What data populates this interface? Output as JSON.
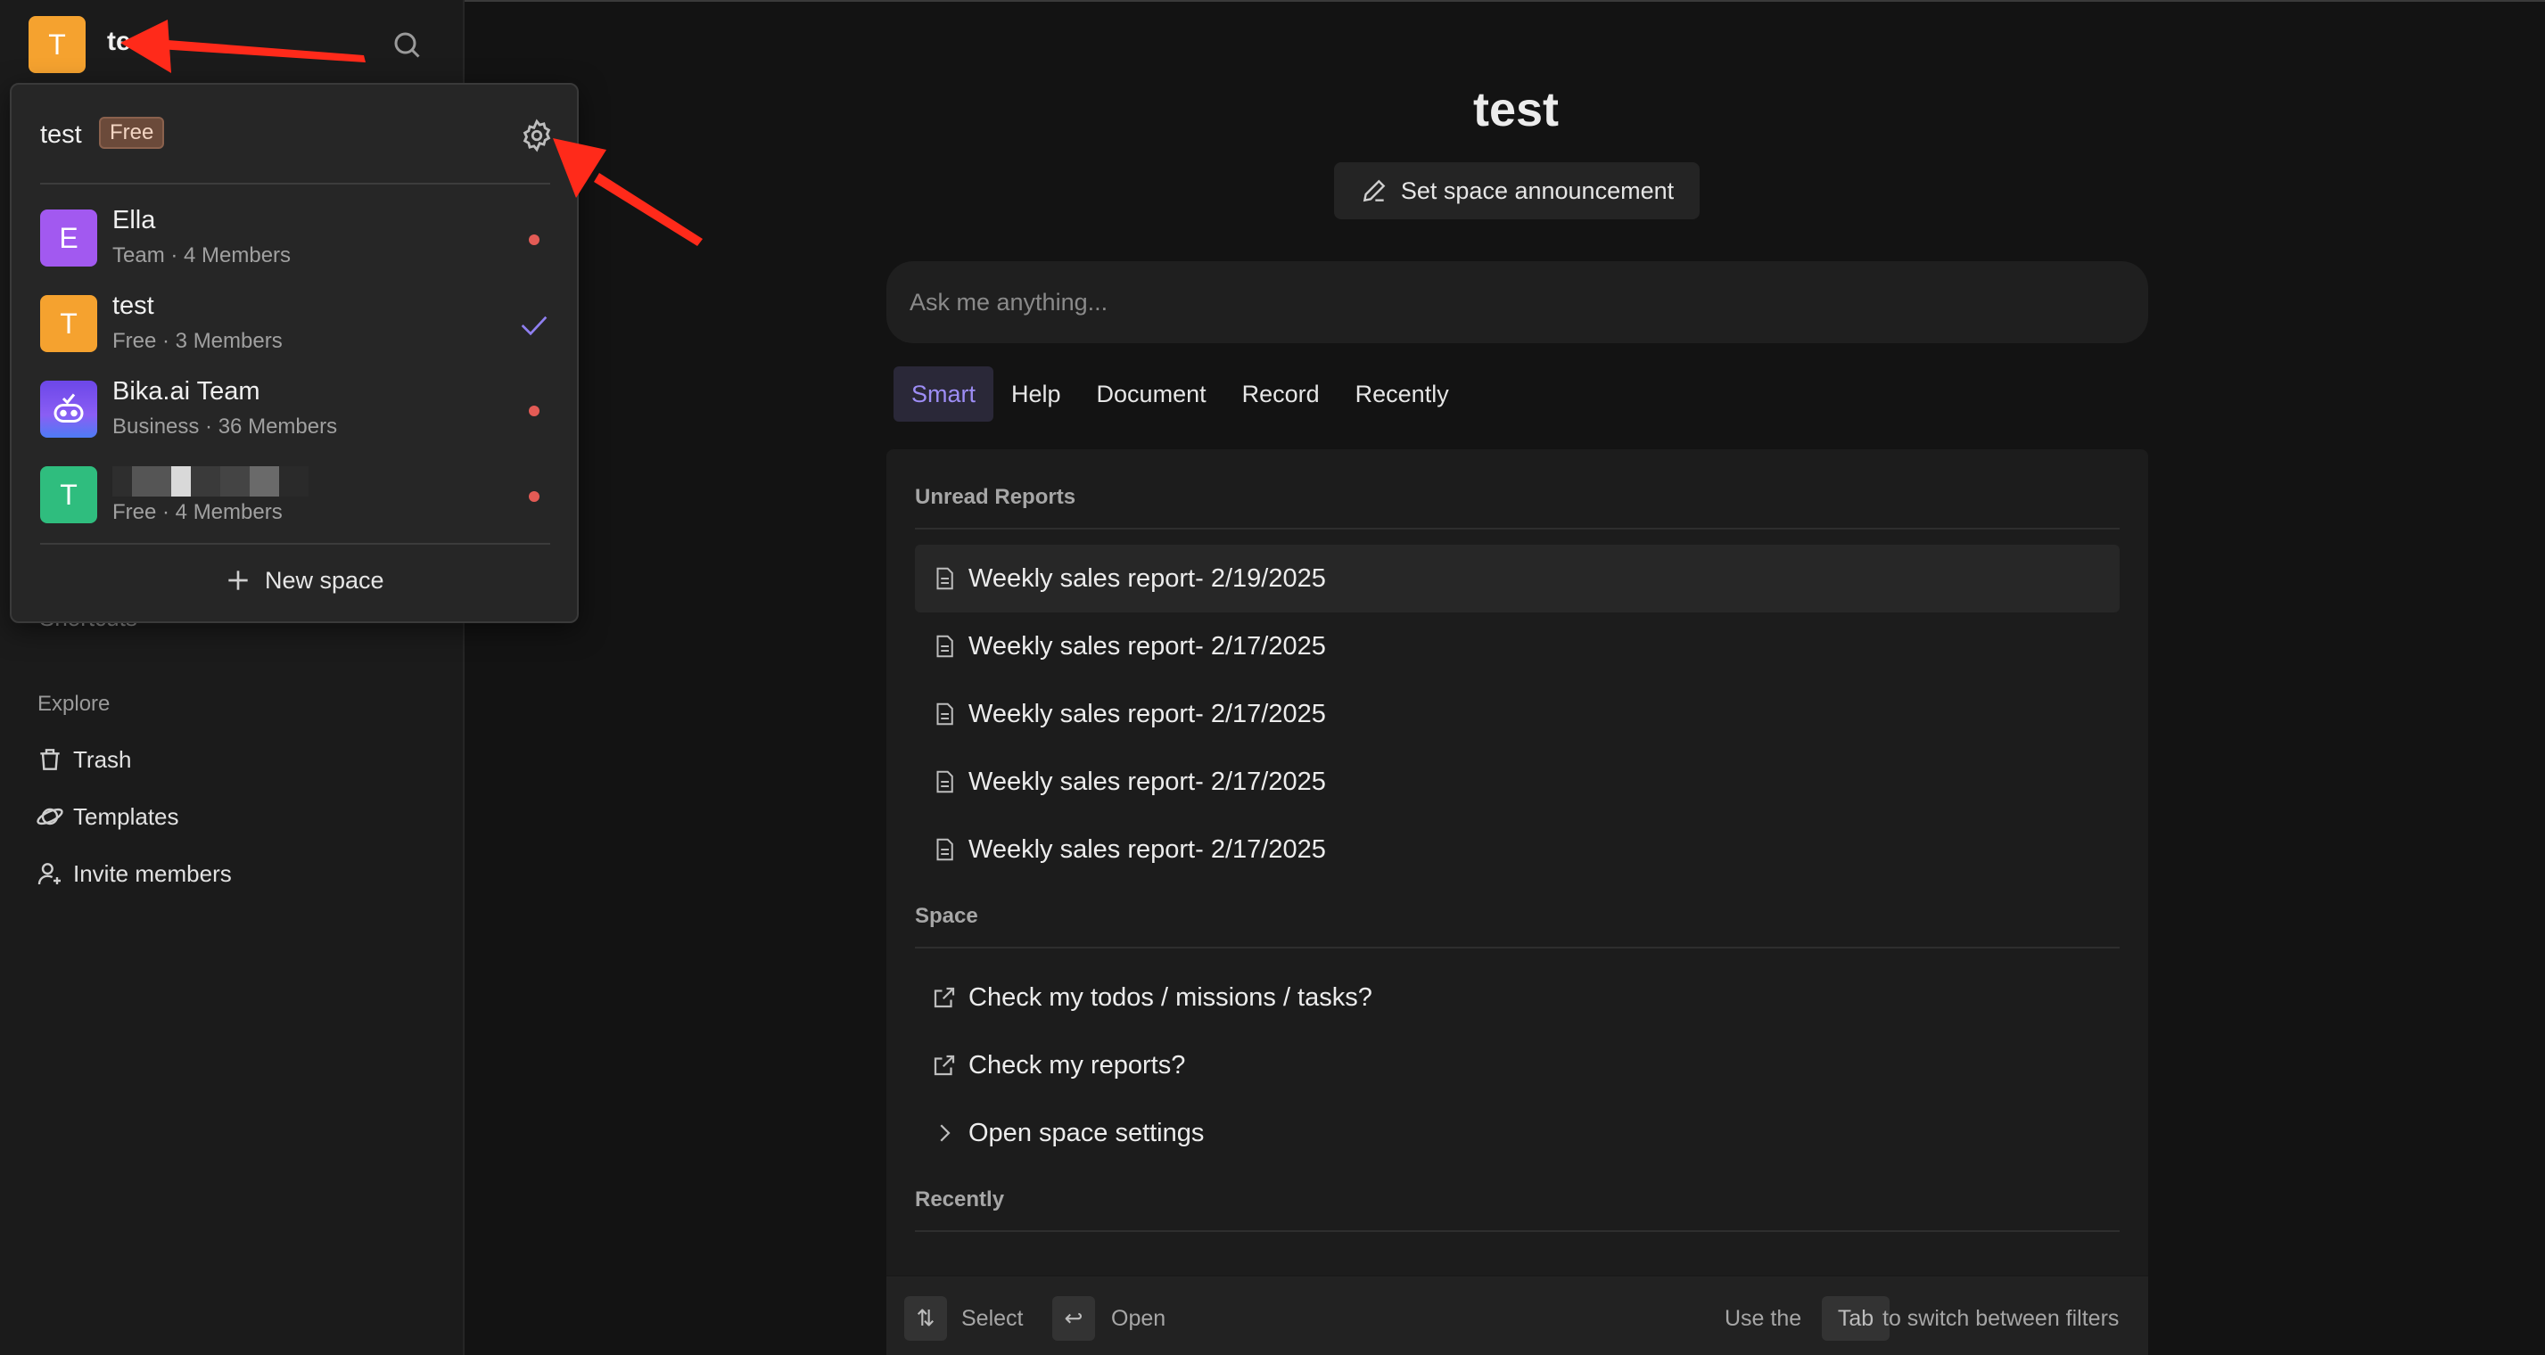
{
  "sidebar": {
    "current_space_initial": "T",
    "current_space_name": "te",
    "current_space_color": "#f5a22f",
    "explore_label": "Explore",
    "shortcuts_label": "Shortcuts",
    "items": [
      {
        "label": "Trash",
        "icon": "trash-icon"
      },
      {
        "label": "Templates",
        "icon": "planet-icon"
      },
      {
        "label": "Invite members",
        "icon": "user-plus-icon"
      }
    ]
  },
  "popover": {
    "title": "test",
    "badge": "Free",
    "spaces": [
      {
        "initial": "E",
        "name": "Ella",
        "sub": "Team · 4 Members",
        "color": "#a259f0",
        "status": "dot"
      },
      {
        "initial": "T",
        "name": "test",
        "sub": "Free · 3 Members",
        "color": "#f5a22f",
        "status": "check"
      },
      {
        "initial": "",
        "name": "Bika.ai Team",
        "sub": "Business · 36 Members",
        "color": "#7b5cf2",
        "status": "dot"
      },
      {
        "initial": "T",
        "name": "",
        "sub": "Free · 4 Members",
        "color": "#2fbd7e",
        "status": "dot"
      }
    ],
    "new_space_label": "New space"
  },
  "main": {
    "title": "test",
    "announce_label": "Set space announcement",
    "ask_placeholder": "Ask me anything...",
    "tabs": [
      "Smart",
      "Help",
      "Document",
      "Record",
      "Recently"
    ],
    "active_tab": "Smart",
    "unread_label": "Unread Reports",
    "reports": [
      "Weekly sales report- 2/19/2025",
      "Weekly sales report- 2/17/2025",
      "Weekly sales report- 2/17/2025",
      "Weekly sales report- 2/17/2025",
      "Weekly sales report- 2/17/2025"
    ],
    "space_label": "Space",
    "space_items": [
      {
        "label": "Check my todos / missions / tasks?",
        "icon": "external-link-icon"
      },
      {
        "label": "Check my reports?",
        "icon": "external-link-icon"
      },
      {
        "label": "Open space settings",
        "icon": "chevron-right-icon"
      }
    ],
    "recently_label": "Recently",
    "footer": {
      "select_label": "Select",
      "open_label": "Open",
      "hint_prefix": "Use the",
      "hint_key": "Tab",
      "hint_suffix": "to switch between filters"
    }
  },
  "accent_color": "#9d8df5",
  "annotation_color": "#ff2a1a"
}
